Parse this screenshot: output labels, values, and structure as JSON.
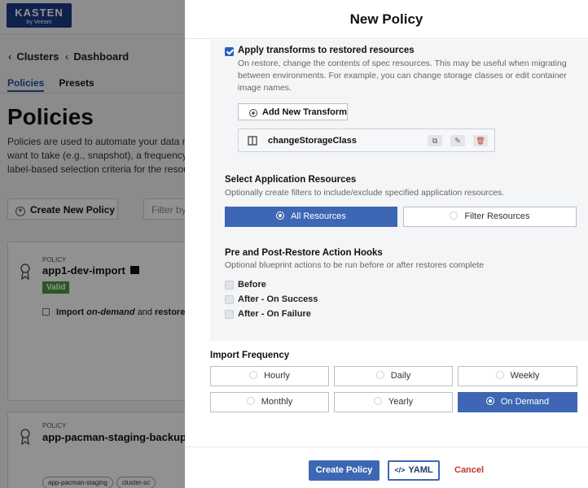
{
  "app": {
    "logo_main": "KASTEN",
    "logo_sub": "by Veeam"
  },
  "background": {
    "breadcrumb": {
      "clusters": "Clusters",
      "dashboard": "Dashboard"
    },
    "tabs": [
      "Policies",
      "Presets"
    ],
    "page_title": "Policies",
    "page_desc_lines": [
      "Policies are used to automate your data mar",
      "want to take (e.g., snapshot), a frequency or",
      "label-based selection criteria for the resourc"
    ],
    "create_button": "Create New Policy",
    "filter_placeholder": "Filter by",
    "cards": [
      {
        "label": "POLICY",
        "name": "app1-dev-import",
        "status": "Valid",
        "line_pre": "Import ",
        "line_em1": "on-demand",
        "line_mid": " and ",
        "line_em2": "restore al"
      },
      {
        "label": "POLICY",
        "name": "app-pacman-staging-backup",
        "chips": [
          "app-pacman-staging",
          "cluster-sc"
        ]
      }
    ]
  },
  "modal": {
    "title": "New Policy",
    "transforms": {
      "checkbox_label": "Apply transforms to restored resources",
      "checked": true,
      "description": "On restore, change the contents of spec resources. This may be useful when migrating between environments. For example, you can change storage classes or edit container image names.",
      "add_button": "Add New Transform",
      "items": [
        {
          "name": "changeStorageClass"
        }
      ]
    },
    "app_resources": {
      "heading": "Select Application Resources",
      "subtitle": "Optionally create filters to include/exclude specified application resources.",
      "options": [
        "All Resources",
        "Filter Resources"
      ],
      "selected": "All Resources"
    },
    "hooks": {
      "heading": "Pre and Post-Restore Action Hooks",
      "subtitle": "Optional blueprint actions to be run before or after restores complete",
      "items": [
        "Before",
        "After - On Success",
        "After - On Failure"
      ]
    },
    "frequency": {
      "heading": "Import Frequency",
      "options": [
        "Hourly",
        "Daily",
        "Weekly",
        "Monthly",
        "Yearly",
        "On Demand"
      ],
      "selected": "On Demand"
    },
    "footer": {
      "create": "Create Policy",
      "yaml": "YAML",
      "cancel": "Cancel"
    }
  },
  "colors": {
    "primary": "#3d67b4",
    "cancel": "#c0392b",
    "valid": "#4a9a3c",
    "logo_bg": "#1f3a8a"
  }
}
